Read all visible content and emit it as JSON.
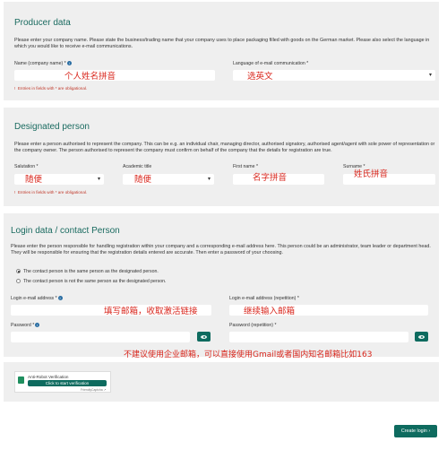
{
  "producer": {
    "title": "Producer data",
    "description": "Please enter your company name. Please state the business/trading name that your company uses to place packaging filled with goods on the German market. Please also select the language in which you would like to receive e-mail communications.",
    "name_label": "Name (company name) *",
    "name_value": "个人姓名拼音",
    "language_label": "Language of e-mail communication *",
    "language_value": "选英文",
    "required_note": "Entries in fields with * are obligational."
  },
  "designated": {
    "title": "Designated person",
    "description": "Please enter a person authorised to represent the company. This can be e.g. an individual chair, managing director, authorised signatory, authorised agent/agent with sole power of representation or the company owner. The person authorised to represent the company must confirm on behalf of the company that the details for registration are true.",
    "salutation_label": "Salutation *",
    "salutation_value": "随便",
    "academic_label": "Academic title",
    "academic_value": "随便",
    "firstname_label": "First name *",
    "firstname_value": "名字拼音",
    "surname_label": "Surname *",
    "surname_value": "姓氏拼音",
    "required_note": "Entries in fields with * are obligational."
  },
  "login": {
    "title": "Login data / contact Person",
    "description": "Please enter the person responsible for handling registration within your company and a corresponding e-mail address here. This person could be an administrator, team leader or department head. They will be responsible for ensuring that the registration details entered are accurate. Then enter a password of your choosing.",
    "radio_same": "The contact person is the same person as the designated person.",
    "radio_not_same": "The contact person is not the same person as the designated person.",
    "email_label": "Login e-mail address *",
    "email_value": "填写邮箱，收取激活链接",
    "email_repeat_label": "Login e-mail address (repetition) *",
    "email_repeat_value": "继续输入邮箱",
    "password_label": "Password *",
    "password_repeat_label": "Password (repetition) *",
    "note": "不建议使用企业邮箱，可以直接使用Gmail或者国内知名邮箱比如163"
  },
  "captcha": {
    "title": "Anti-Robot Verification",
    "button": "Click to start verification",
    "brand": "FriendlyCaptcha ↗"
  },
  "actions": {
    "create_login": "Create login"
  }
}
